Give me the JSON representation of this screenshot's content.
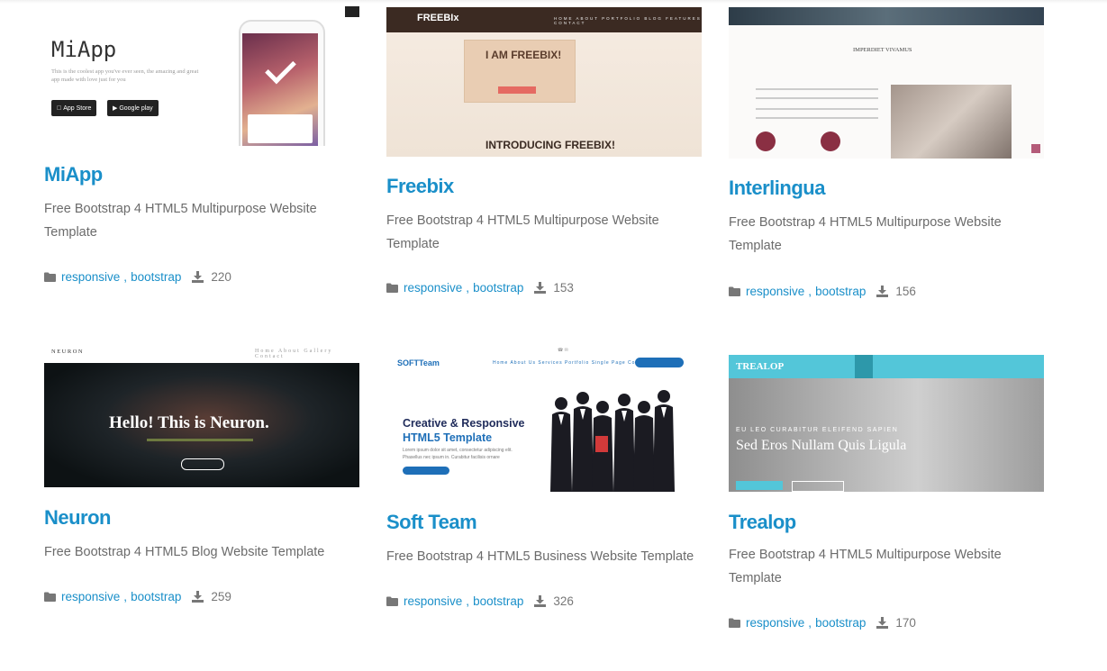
{
  "meta_labels": {
    "comma": ","
  },
  "cards": [
    {
      "title": "MiApp",
      "description": "Free Bootstrap 4 HTML5 Multipurpose Website Template",
      "tags": [
        "responsive",
        "bootstrap"
      ],
      "downloads": "220",
      "preview": {
        "logo": "MiApp",
        "subtitle": "This is the coolest app you've ever seen, the amazing and great app made with love just for you",
        "appstore": "App Store",
        "googleplay": "Google play"
      }
    },
    {
      "title": "Freebix",
      "description": "Free Bootstrap 4 HTML5 Multipurpose Website Template",
      "tags": [
        "responsive",
        "bootstrap"
      ],
      "downloads": "153",
      "preview": {
        "brand": "FREEBIx",
        "nav": "HOME ABOUT PORTFOLIO BLOG FEATURES CONTACT",
        "heading": "I AM FREEBIX!",
        "intro": "INTRODUCING FREEBIX!"
      }
    },
    {
      "title": "Interlingua",
      "description": "Free Bootstrap 4 HTML5 Multipurpose Website Template",
      "tags": [
        "responsive",
        "bootstrap"
      ],
      "downloads": "156",
      "preview": {
        "heading": "IMPERDIET VIVAMUS"
      }
    },
    {
      "title": "Neuron",
      "description": "Free Bootstrap 4 HTML5 Blog Website Template",
      "tags": [
        "responsive",
        "bootstrap"
      ],
      "downloads": "259",
      "preview": {
        "brand": "NEURON",
        "nav": "Home About Gallery Contact",
        "headline": "Hello! This is Neuron."
      }
    },
    {
      "title": "Soft Team",
      "description": "Free Bootstrap 4 HTML5 Business Website Template",
      "tags": [
        "responsive",
        "bootstrap"
      ],
      "downloads": "326",
      "preview": {
        "brand": "SOFTTeam",
        "nav": "Home About Us Services Portfolio Single Page Contact Us",
        "hero_line1": "Creative & Responsive",
        "hero_line2": "HTML5 Template",
        "hero_text": "Lorem ipsum dolor sit amet, consectetur adipiscing elit. Phasellus nec ipsum in. Curabitur facilisis ornare"
      }
    },
    {
      "title": "Trealop",
      "description": "Free Bootstrap 4 HTML5 Multipurpose Website Template",
      "tags": [
        "responsive",
        "bootstrap"
      ],
      "downloads": "170",
      "preview": {
        "brand": "TREALOP",
        "eyebrow": "EU LEO CURABITUR ELEIFEND SAPIEN",
        "headline": "Sed Eros Nullam Quis Ligula"
      }
    }
  ],
  "colors": {
    "link": "#1a8fc9",
    "text": "#6b6b6b",
    "icon": "#777777"
  }
}
